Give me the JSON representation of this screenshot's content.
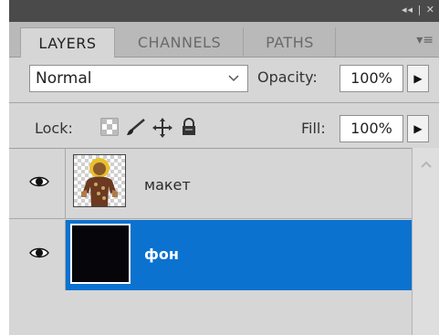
{
  "panel": {
    "title_controls": "◂◂ | ✕",
    "tabs": [
      {
        "label": "LAYERS",
        "active": true
      },
      {
        "label": "CHANNELS",
        "active": false
      },
      {
        "label": "PATHS",
        "active": false
      }
    ],
    "menu_icon": "panel-menu-icon"
  },
  "blend": {
    "mode": "Normal"
  },
  "opacity": {
    "label": "Opacity:",
    "value": "100%"
  },
  "lock": {
    "label": "Lock:",
    "icons": [
      "lock-transparent-icon",
      "lock-brush-icon",
      "lock-position-icon",
      "lock-all-icon"
    ]
  },
  "fill": {
    "label": "Fill:",
    "value": "100%"
  },
  "layers": [
    {
      "name": "макет",
      "visible": true,
      "selected": false,
      "thumbnail": "person-on-transparent"
    },
    {
      "name": "фон",
      "visible": true,
      "selected": true,
      "thumbnail": "black-fill"
    }
  ],
  "colors": {
    "selection": "#0b72d0",
    "panel_bg": "#d6d6d6",
    "tabbar": "#b9b9b9"
  }
}
